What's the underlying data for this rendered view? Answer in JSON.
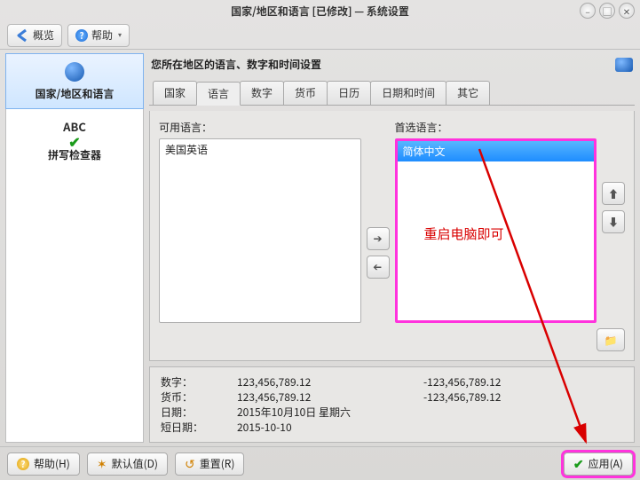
{
  "window": {
    "title": "国家/地区和语言 [已修改] — 系统设置"
  },
  "toolbar": {
    "overview": "概览",
    "help": "帮助"
  },
  "sidebar": {
    "items": [
      {
        "label": "国家/地区和语言"
      },
      {
        "label": "拼写检查器"
      }
    ]
  },
  "main": {
    "heading": "您所在地区的语言、数字和时间设置",
    "tabs": [
      "国家",
      "语言",
      "数字",
      "货币",
      "日历",
      "日期和时间",
      "其它"
    ],
    "active_tab": 1,
    "available_label": "可用语言：",
    "preferred_label": "首选语言：",
    "available_items": [
      "美国英语"
    ],
    "preferred_items": [
      "简体中文"
    ],
    "annotation": "重启电脑即可"
  },
  "preview": {
    "rows": [
      {
        "k": "数字：",
        "v1": "123,456,789.12",
        "v2": "-123,456,789.12"
      },
      {
        "k": "货币：",
        "v1": "123,456,789.12",
        "v2": "-123,456,789.12"
      },
      {
        "k": "日期：",
        "v1": "2015年10月10日 星期六",
        "v2": ""
      },
      {
        "k": "短日期：",
        "v1": "2015-10-10",
        "v2": ""
      }
    ]
  },
  "buttons": {
    "help": "帮助(H)",
    "defaults": "默认值(D)",
    "reset": "重置(R)",
    "apply": "应用(A)"
  }
}
